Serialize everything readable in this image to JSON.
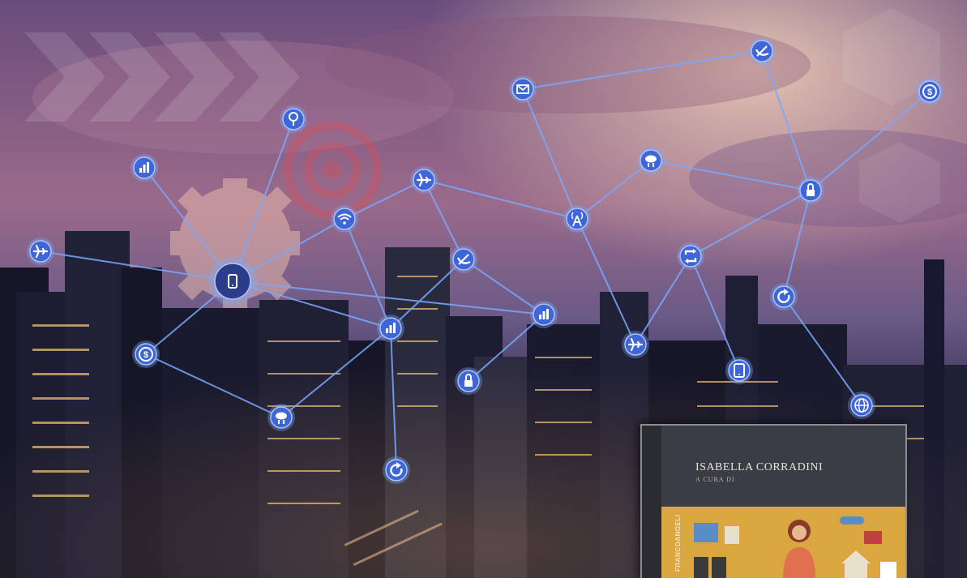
{
  "colors": {
    "sky_top": "#5a4a78",
    "sky_mid": "#9a6a88",
    "sky_glow": "#d8b0a8",
    "city_dark": "#151528",
    "network_line": "#6fa3ff",
    "node_fill": "#3f66d6",
    "gear": "#e8b8a8",
    "book_cover": "#3a3d45",
    "book_art": "#d9a640"
  },
  "network_nodes": [
    {
      "id": "map-pin",
      "icon": "map-pin-icon"
    },
    {
      "id": "chart-1",
      "icon": "bar-chart-icon"
    },
    {
      "id": "plane-1",
      "icon": "airplane-icon"
    },
    {
      "id": "hub",
      "icon": "smartphone-icon"
    },
    {
      "id": "dollar-1",
      "icon": "dollar-icon"
    },
    {
      "id": "cloud-1",
      "icon": "cloud-transfer-icon"
    },
    {
      "id": "wifi",
      "icon": "wifi-icon"
    },
    {
      "id": "plane-2",
      "icon": "airplane-icon"
    },
    {
      "id": "satellite-1",
      "icon": "satellite-dish-icon"
    },
    {
      "id": "chart-2",
      "icon": "bar-chart-icon"
    },
    {
      "id": "chart-3",
      "icon": "bar-chart-icon"
    },
    {
      "id": "refresh-1",
      "icon": "refresh-icon"
    },
    {
      "id": "lock-1",
      "icon": "lock-icon"
    },
    {
      "id": "mail",
      "icon": "mail-icon"
    },
    {
      "id": "antenna",
      "icon": "antenna-icon"
    },
    {
      "id": "cloud-2",
      "icon": "cloud-transfer-icon"
    },
    {
      "id": "satellite-2",
      "icon": "satellite-dish-icon"
    },
    {
      "id": "dollar-2",
      "icon": "dollar-icon"
    },
    {
      "id": "lock-2",
      "icon": "lock-icon"
    },
    {
      "id": "sync",
      "icon": "sync-icon"
    },
    {
      "id": "refresh-2",
      "icon": "refresh-icon"
    },
    {
      "id": "plane-3",
      "icon": "airplane-icon"
    },
    {
      "id": "tablet",
      "icon": "tablet-icon"
    },
    {
      "id": "globe",
      "icon": "globe-icon"
    }
  ],
  "book": {
    "author": "ISABELLA CORRADINI",
    "subtitle": "A CURA DI",
    "publisher": "FRANCOANGELI"
  }
}
